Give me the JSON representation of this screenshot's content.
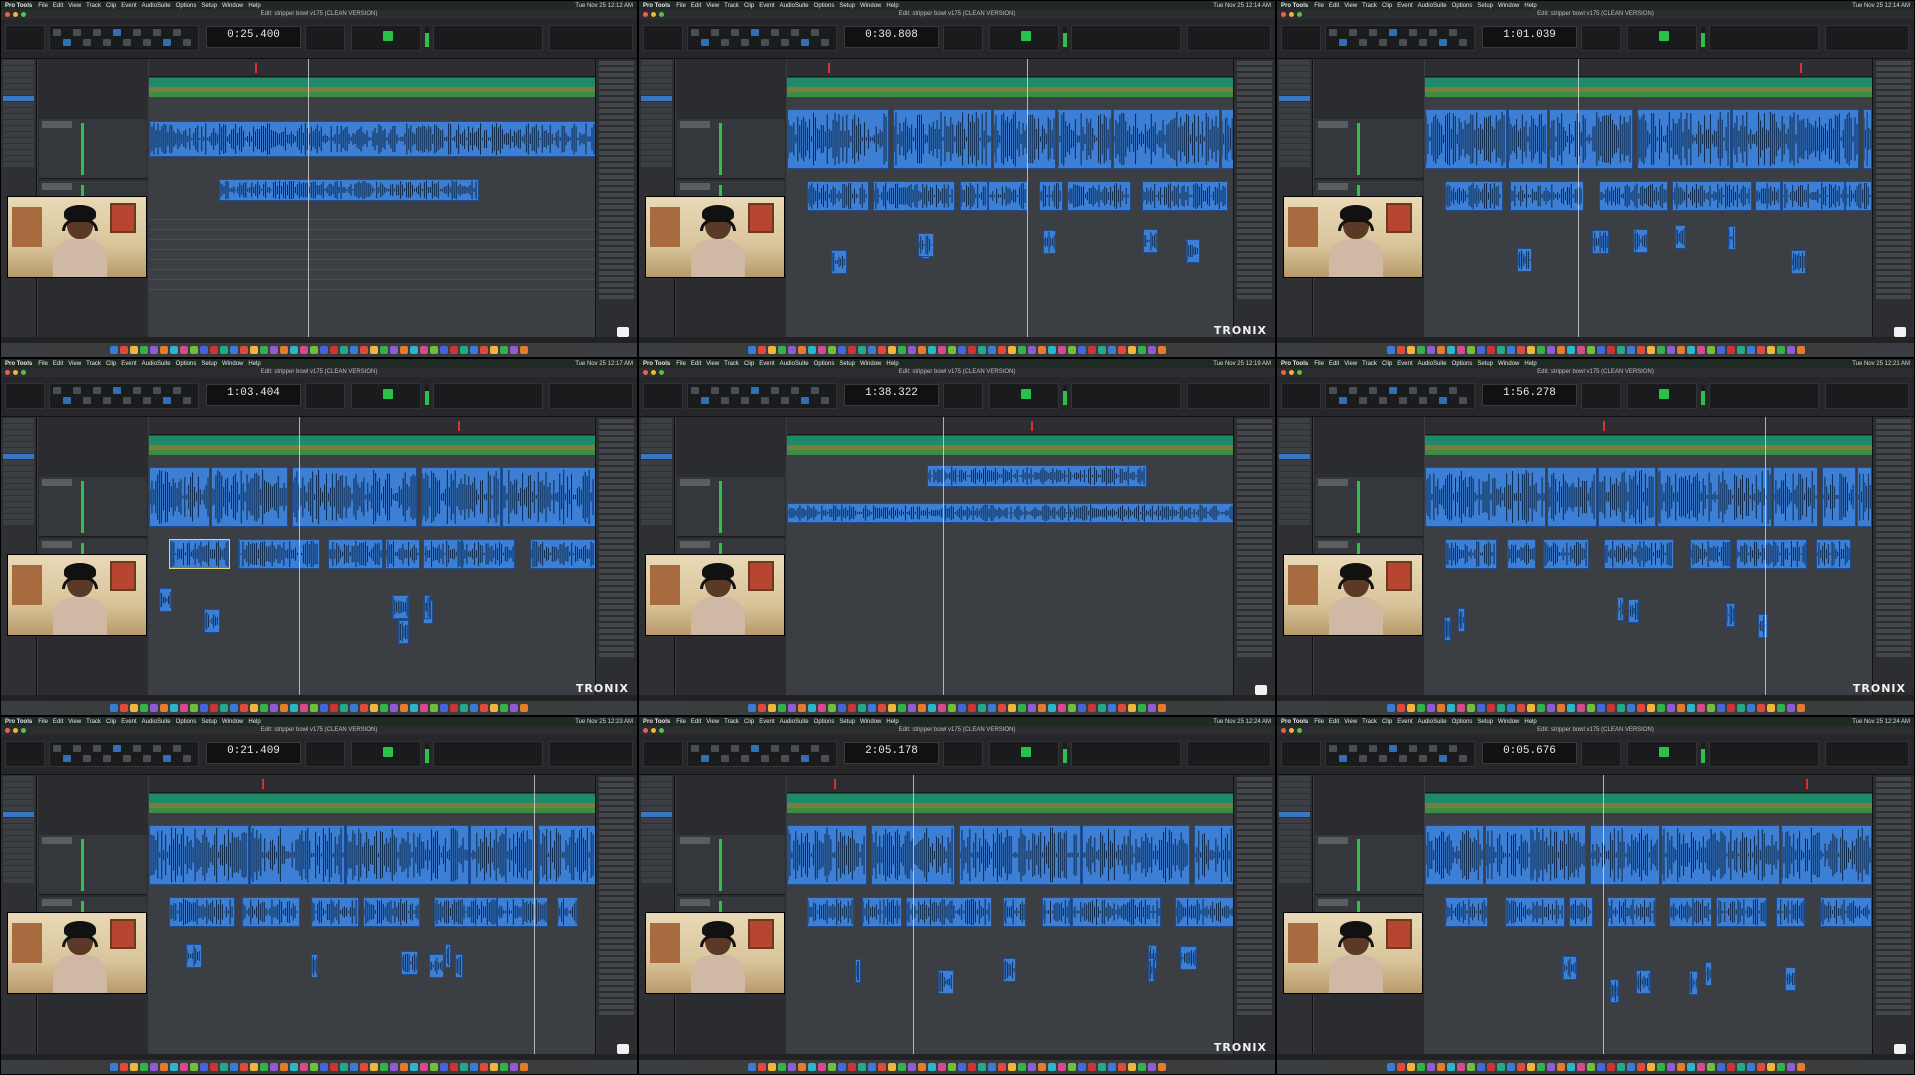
{
  "menubar": {
    "app": "Pro Tools",
    "items": [
      "File",
      "Edit",
      "View",
      "Track",
      "Clip",
      "Event",
      "AudioSuite",
      "Options",
      "Setup",
      "Window",
      "Help"
    ]
  },
  "window_title": "Edit: stripper bowl v175 (CLEAN VERSION)",
  "brand": "TRONIX",
  "colors": {
    "clip_blue": "#3c7fd4",
    "marker_green": "#1f8a67",
    "meter_green": "#2ec04b",
    "selection": "#e4d770"
  },
  "frames": [
    {
      "counter": "0:25.400",
      "clock": "Tue Nov 25  12:12 AM",
      "logo": "small"
    },
    {
      "counter": "0:30.808",
      "clock": "Tue Nov 25  12:14 AM",
      "logo": "text"
    },
    {
      "counter": "1:01.039",
      "clock": "Tue Nov 25  12:14 AM",
      "logo": "small"
    },
    {
      "counter": "1:03.404",
      "clock": "Tue Nov 25  12:17 AM",
      "logo": "text"
    },
    {
      "counter": "1:38.322",
      "clock": "Tue Nov 25  12:19 AM",
      "logo": "small"
    },
    {
      "counter": "1:56.278",
      "clock": "Tue Nov 25  12:21 AM",
      "logo": "text"
    },
    {
      "counter": "0:21.409",
      "clock": "Tue Nov 25  12:23 AM",
      "logo": "small"
    },
    {
      "counter": "2:05.178",
      "clock": "Tue Nov 25  12:24 AM",
      "logo": "text"
    },
    {
      "counter": "0:05.676",
      "clock": "Tue Nov 25  12:24 AM",
      "logo": "small"
    }
  ]
}
